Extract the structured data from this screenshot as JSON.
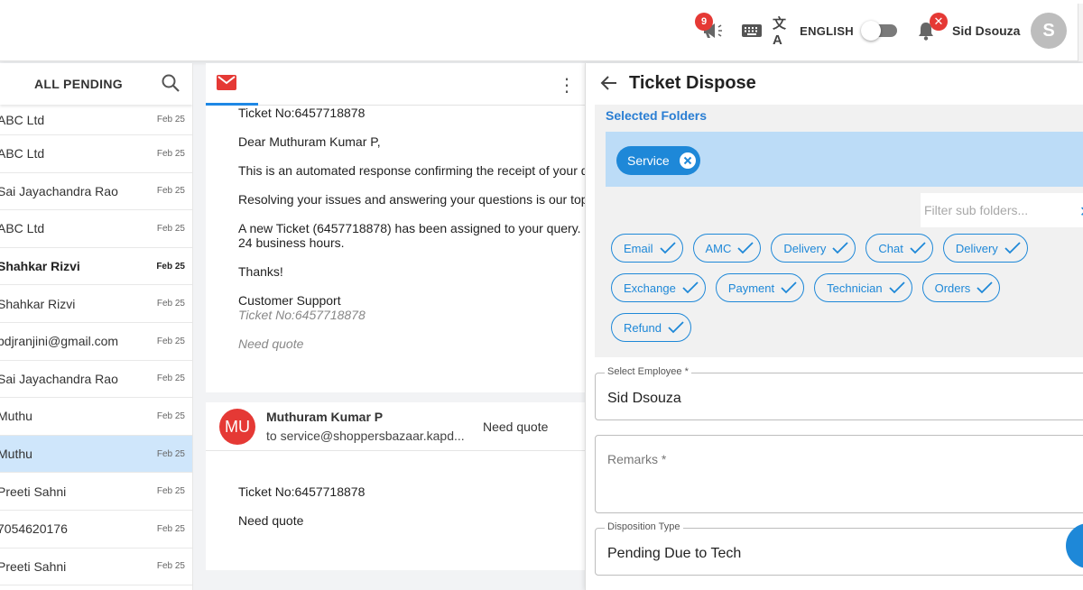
{
  "topbar": {
    "announce_badge": "9",
    "language": "ENGLISH",
    "user_name": "Sid Dsouza",
    "avatar_initial": "S",
    "bell_badge": "✕"
  },
  "left_list": {
    "title": "ALL PENDING",
    "items": [
      {
        "name": "ABC Ltd",
        "date": "Feb 25"
      },
      {
        "name": "ABC Ltd",
        "date": "Feb 25"
      },
      {
        "name": "Sai Jayachandra Rao",
        "date": "Feb 25"
      },
      {
        "name": "ABC Ltd",
        "date": "Feb 25"
      },
      {
        "name": "Shahkar Rizvi",
        "date": "Feb 25"
      },
      {
        "name": "Shahkar Rizvi",
        "date": "Feb 25"
      },
      {
        "name": "pdjranjini@gmail.com",
        "date": "Feb 25"
      },
      {
        "name": "Sai Jayachandra Rao",
        "date": "Feb 25"
      },
      {
        "name": "Muthu",
        "date": "Feb 25"
      },
      {
        "name": "Muthu",
        "date": "Feb 25"
      },
      {
        "name": "Preeti Sahni",
        "date": "Feb 25"
      },
      {
        "name": "7054620176",
        "date": "Feb 25"
      },
      {
        "name": "Preeti Sahni",
        "date": "Feb 25"
      }
    ]
  },
  "email1": {
    "ticket_no": "Ticket No:6457718878",
    "greeting": "Dear Muthuram Kumar P,",
    "line1": "This is an automated response confirming the receipt of your q",
    "line2": "Resolving your issues and answering your questions is our top",
    "line3a": "A new Ticket (6457718878) has been assigned to your query. .",
    "line3b": "24 business hours.",
    "thanks": "Thanks!",
    "signature": "Customer Support",
    "ticket_italic": "Ticket No:6457718878",
    "quote_italic": "Need quote"
  },
  "email2": {
    "initials": "MU",
    "sender": "Muthuram Kumar P",
    "to": "to service@shoppersbazaar.kapd...",
    "subject": "Need quote",
    "ticket_no": "Ticket No:6457718878",
    "body": "Need quote"
  },
  "dispose": {
    "title": "Ticket Dispose",
    "selected_folders_label": "Selected Folders",
    "selected_chip": "Service",
    "filter_placeholder": "Filter sub folders...",
    "subfolders_row1": [
      "Email",
      "AMC",
      "Delivery",
      "Chat",
      "Delivery"
    ],
    "subfolders_row2": [
      "Exchange",
      "Payment",
      "Technician",
      "Orders"
    ],
    "subfolders_row3": [
      "Refund"
    ],
    "employee_label": "Select Employee *",
    "employee_value": "Sid Dsouza",
    "remarks_placeholder": "Remarks *",
    "disposition_label": "Disposition Type",
    "disposition_value": "Pending Due to Tech"
  },
  "colors": {
    "accent": "#1e88d8",
    "badge_red": "#e53935",
    "selected_row": "#cfe6fb",
    "selected_bar": "#bcdcf7"
  }
}
